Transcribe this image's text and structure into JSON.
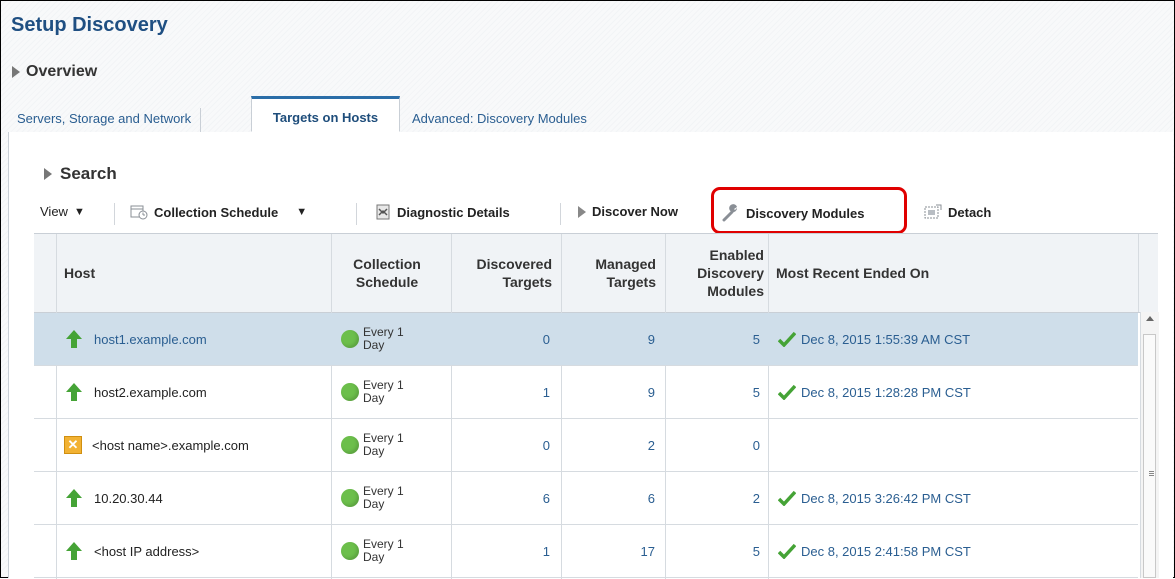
{
  "page": {
    "title": "Setup Discovery",
    "overview": "Overview"
  },
  "tabs": [
    {
      "label": "Servers, Storage and Network"
    },
    {
      "label": "Targets on Hosts"
    },
    {
      "label": "Advanced: Discovery Modules"
    }
  ],
  "active_tab": "Targets on Hosts",
  "search": {
    "label": "Search"
  },
  "toolbar": {
    "view": "View",
    "collection_schedule": "Collection Schedule",
    "diagnostic_details": "Diagnostic Details",
    "discover_now": "Discover Now",
    "discovery_modules": "Discovery Modules",
    "detach": "Detach"
  },
  "table": {
    "headers": {
      "host": "Host",
      "schedule_1": "Collection",
      "schedule_2": "Schedule",
      "discovered_1": "Discovered",
      "discovered_2": "Targets",
      "managed_1": "Managed",
      "managed_2": "Targets",
      "enabled_1": "Enabled",
      "enabled_2": "Discovery",
      "enabled_3": "Modules",
      "recent": "Most Recent Ended On"
    },
    "rows": [
      {
        "host": "host1.example.com",
        "status": "up",
        "schedule_1": "Every 1",
        "schedule_2": "Day",
        "discovered": "0",
        "managed": "9",
        "enabled": "5",
        "recent": "Dec 8, 2015 1:55:39 AM CST"
      },
      {
        "host": "host2.example.com",
        "status": "up",
        "schedule_1": "Every 1",
        "schedule_2": "Day",
        "discovered": "1",
        "managed": "9",
        "enabled": "5",
        "recent": "Dec 8, 2015 1:28:28 PM CST"
      },
      {
        "host": "<host name>.example.com",
        "status": "warning",
        "schedule_1": "Every 1",
        "schedule_2": "Day",
        "discovered": "0",
        "managed": "2",
        "enabled": "0",
        "recent": ""
      },
      {
        "host": "10.20.30.44",
        "status": "up",
        "schedule_1": "Every 1",
        "schedule_2": "Day",
        "discovered": "6",
        "managed": "6",
        "enabled": "2",
        "recent": "Dec 8, 2015 3:26:42 PM CST"
      },
      {
        "host": "<host IP address>",
        "status": "up",
        "schedule_1": "Every 1",
        "schedule_2": "Day",
        "discovered": "1",
        "managed": "17",
        "enabled": "5",
        "recent": "Dec 8, 2015 2:41:58 PM CST"
      }
    ]
  },
  "colors": {
    "accent": "#2a5e91",
    "selected_row": "#cfdeea",
    "status_up": "#45a336",
    "schedule_dot": "#6cbf4b",
    "highlight": "#e00000"
  }
}
